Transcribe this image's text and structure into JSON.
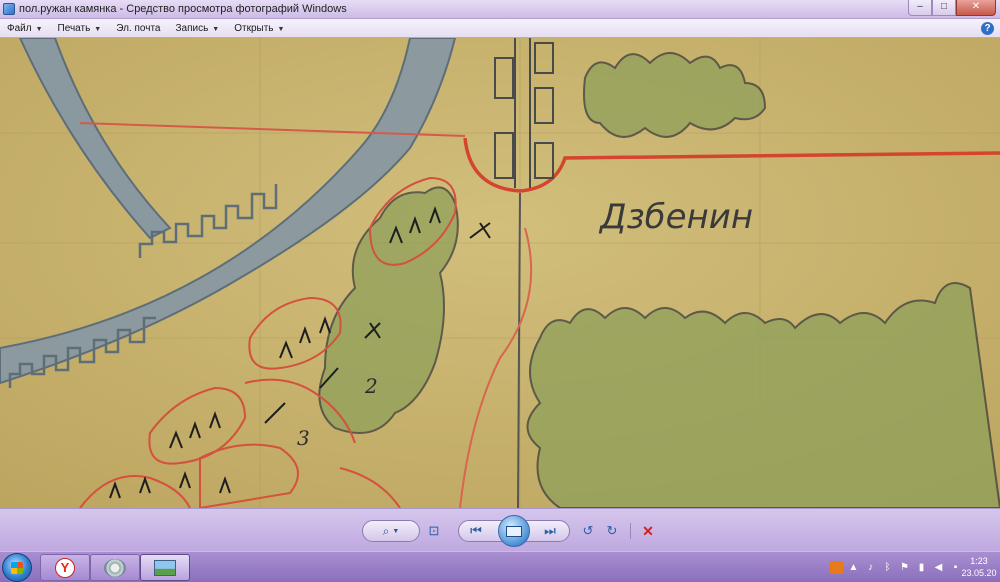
{
  "window": {
    "title": "пол.ружан камянка - Средство просмотра фотографий Windows",
    "minimize_glyph": "–",
    "maximize_glyph": "□",
    "close_glyph": "✕"
  },
  "menu": {
    "items": [
      {
        "label": "Файл",
        "has_dropdown": true
      },
      {
        "label": "Печать",
        "has_dropdown": true
      },
      {
        "label": "Эл. почта",
        "has_dropdown": false
      },
      {
        "label": "Запись",
        "has_dropdown": true
      },
      {
        "label": "Открыть",
        "has_dropdown": true
      }
    ],
    "help_glyph": "?"
  },
  "image": {
    "map_label": "Дзбенин",
    "numerals": [
      "2",
      "3"
    ]
  },
  "toolbar": {
    "zoom_glyph": "⌕",
    "fit_glyph": "⊡",
    "prev_glyph": "⏮",
    "next_glyph": "⏭",
    "rotate_ccw_glyph": "↺",
    "rotate_cw_glyph": "↻",
    "delete_glyph": "✕"
  },
  "taskbar": {
    "yandex_glyph": "Y",
    "clock_time": "1:23",
    "clock_date": "23.05.20"
  },
  "colors": {
    "accent": "#2a5ea8",
    "delete": "#d02020",
    "title_bar": "#cdbbe6"
  }
}
